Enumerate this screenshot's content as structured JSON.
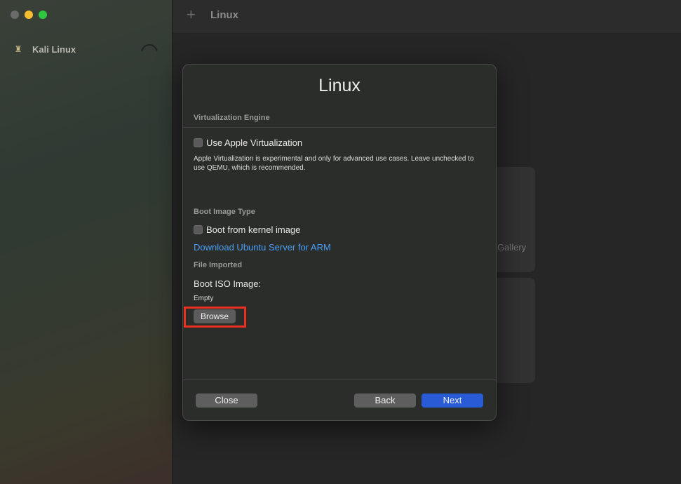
{
  "sidebar": {
    "items": [
      {
        "label": "Kali Linux",
        "icon": "kali-icon"
      }
    ]
  },
  "toolbar": {
    "title": "Linux",
    "add_icon": "plus-icon"
  },
  "background": {
    "card_text": "Gallery"
  },
  "dialog": {
    "title": "Linux",
    "virtualization": {
      "section_label": "Virtualization Engine",
      "checkbox_label": "Use Apple Virtualization",
      "help_text": "Apple Virtualization is experimental and only for advanced use cases. Leave unchecked to use QEMU, which is recommended."
    },
    "boot_image": {
      "section_label": "Boot Image Type",
      "checkbox_label": "Boot from kernel image",
      "link": "Download Ubuntu Server for ARM"
    },
    "file": {
      "section_label": "File Imported",
      "field_title": "Boot ISO Image:",
      "field_value": "Empty",
      "browse_label": "Browse"
    },
    "footer": {
      "close_label": "Close",
      "back_label": "Back",
      "next_label": "Next"
    }
  },
  "colors": {
    "accent": "#2a5bd7",
    "link": "#4a9ef5",
    "highlight": "#e8311f"
  }
}
